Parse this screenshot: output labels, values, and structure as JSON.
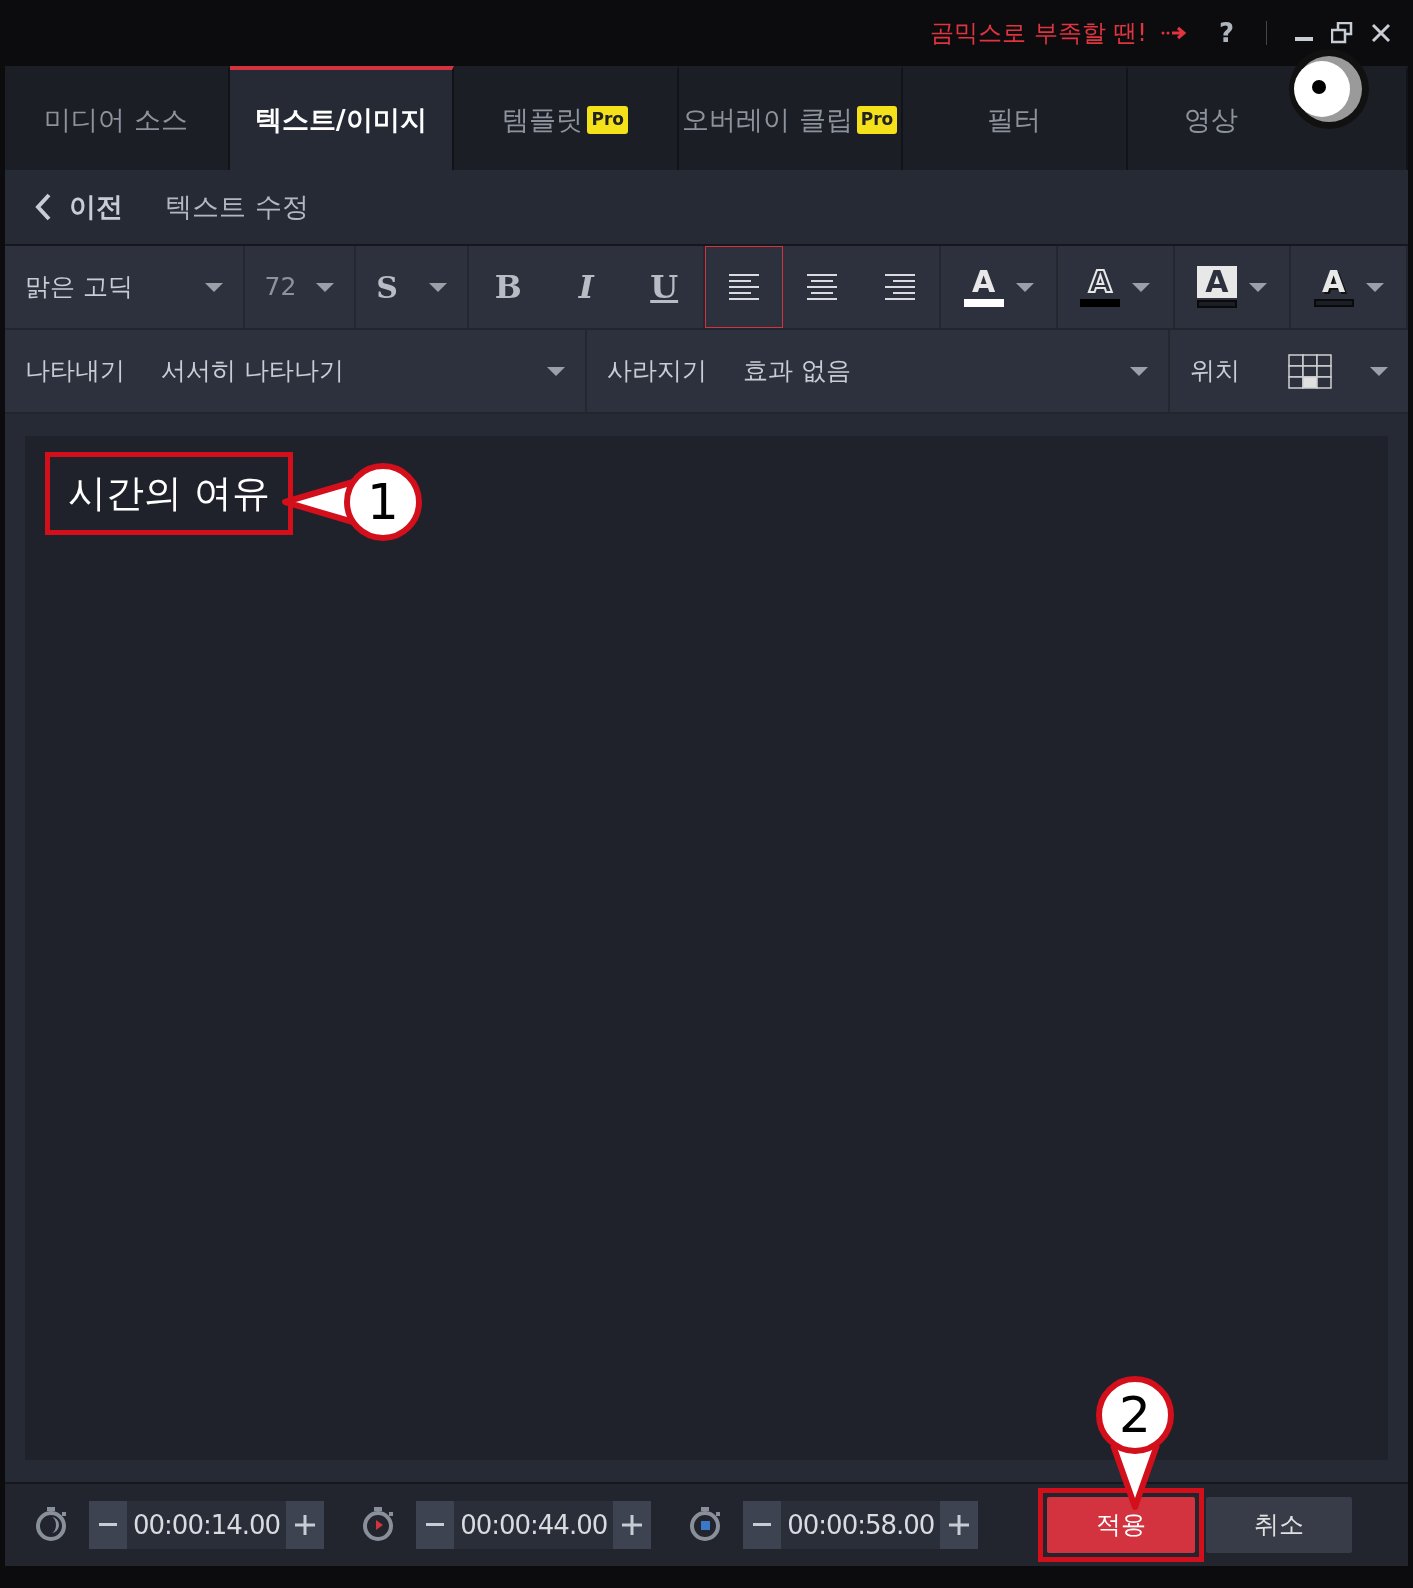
{
  "title_bar": {
    "promo": "곰믹스로 부족할 땐!",
    "help": "?"
  },
  "tabs": [
    {
      "label": "미디어 소스",
      "selected": false
    },
    {
      "label": "텍스트/이미지",
      "selected": true
    },
    {
      "label": "템플릿",
      "selected": false,
      "badge": "Pro"
    },
    {
      "label": "오버레이 클립",
      "selected": false,
      "badge": "Pro"
    },
    {
      "label": "필터",
      "selected": false
    },
    {
      "label": "영상",
      "selected": false
    }
  ],
  "subheader": {
    "back": "이전",
    "title": "텍스트 수정"
  },
  "format_toolbar": {
    "font": "맑은 고딕",
    "size": "72",
    "style": "S",
    "toggles": [
      {
        "kind": "bold",
        "label": "B"
      },
      {
        "kind": "italic",
        "label": "I"
      },
      {
        "kind": "underline",
        "label": "U"
      }
    ],
    "align": [
      {
        "kind": "left",
        "selected": true
      },
      {
        "kind": "center",
        "selected": false
      },
      {
        "kind": "right",
        "selected": false
      }
    ],
    "colors": [
      {
        "kind": "fill",
        "letter": "A",
        "color": "#ffffff"
      },
      {
        "kind": "outline",
        "letter": "A",
        "color": "#000000"
      },
      {
        "kind": "box",
        "letter": "A",
        "color": "#1b1e25"
      },
      {
        "kind": "shadow",
        "letter": "A",
        "color": "#1b1e25"
      }
    ]
  },
  "effects": {
    "in_label": "나타내기",
    "in_value": "서서히 나타나기",
    "out_label": "사라지기",
    "out_value": "효과 없음",
    "position_label": "위치",
    "position_cells": [
      {
        "selected": false
      },
      {
        "selected": false
      },
      {
        "selected": false
      },
      {
        "selected": false
      },
      {
        "selected": false
      },
      {
        "selected": false
      },
      {
        "selected": false
      },
      {
        "selected": true
      },
      {
        "selected": false
      }
    ]
  },
  "editor": {
    "text": "시간의 여유"
  },
  "timers": [
    {
      "kind": "duration",
      "time": "00:00:14.00"
    },
    {
      "kind": "start",
      "time": "00:00:44.00"
    },
    {
      "kind": "end",
      "time": "00:00:58.00"
    }
  ],
  "buttons": {
    "apply": "적용",
    "cancel": "취소"
  },
  "callouts": [
    {
      "label": "1"
    },
    {
      "label": "2"
    }
  ]
}
